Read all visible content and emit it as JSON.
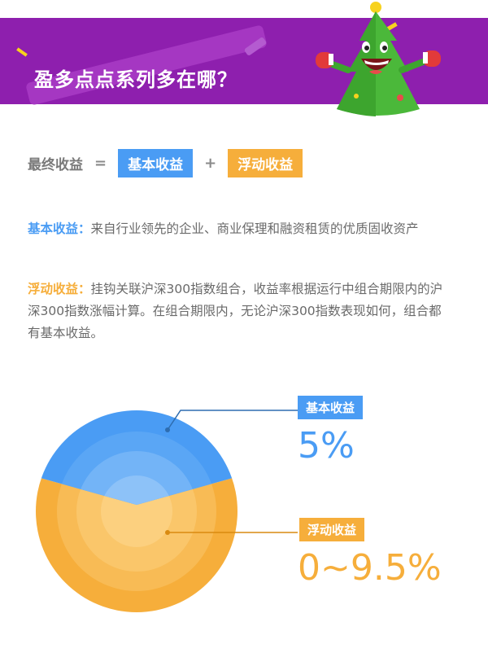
{
  "header": {
    "title": "盈多点点系列多在哪？"
  },
  "formula": {
    "total_label": "最终收益",
    "equals": "=",
    "basic_label": "基本收益",
    "plus": "+",
    "floating_label": "浮动收益"
  },
  "descriptions": {
    "basic": {
      "key": "基本收益：",
      "text": "来自行业领先的企业、商业保理和融资租赁的优质固收资产"
    },
    "floating": {
      "key": "浮动收益：",
      "text": "挂钩关联沪深300指数组合，收益率根据运行中组合期限内的沪深300指数涨幅计算。在组合期限内，无论沪深300指数表现如何，组合都有基本收益。"
    }
  },
  "chart_data": {
    "type": "pie",
    "slices": [
      {
        "name": "基本收益",
        "value_label": "5%",
        "color": "#4a9cf4"
      },
      {
        "name": "浮动收益",
        "value_label": "0~9.5%",
        "color": "#f6ae3b"
      }
    ]
  },
  "colors": {
    "header": "#8e1fae",
    "blue": "#4a9cf4",
    "orange": "#f6ae3b",
    "text": "#6a6a6a"
  },
  "icons": {
    "mascot": "christmas-tree-mascot-icon"
  }
}
